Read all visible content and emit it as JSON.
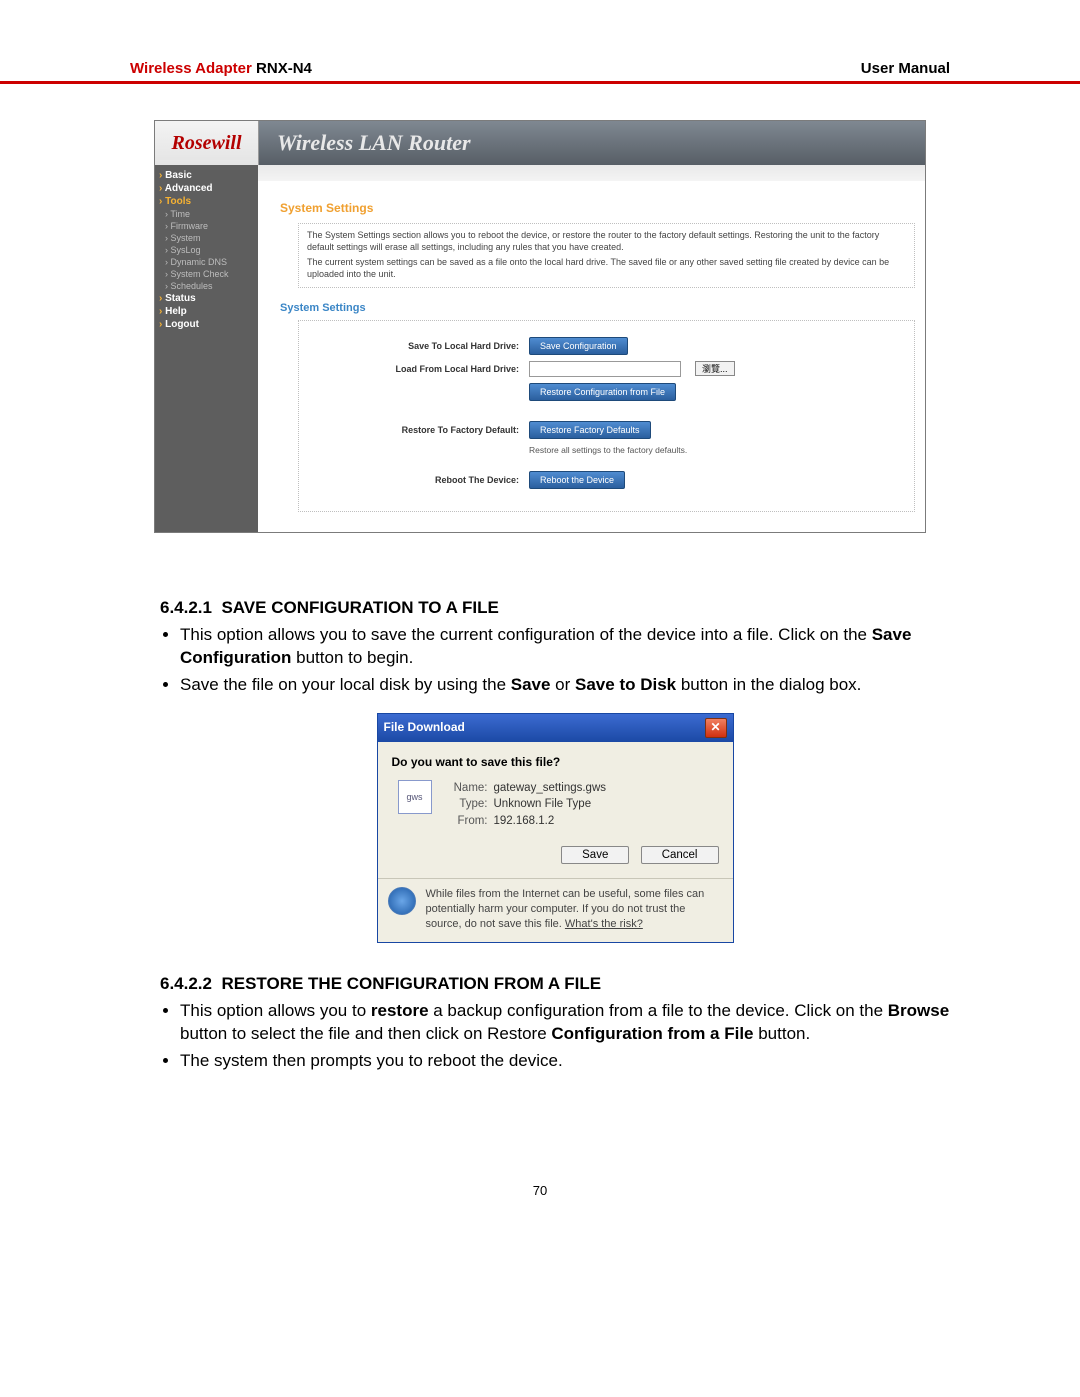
{
  "header": {
    "brand": "Wireless Adapter",
    "model": "RNX-N4",
    "right": "User Manual"
  },
  "router": {
    "logo": "Rosewill",
    "title": "Wireless LAN Router",
    "sidebar": {
      "basic": "Basic",
      "advanced": "Advanced",
      "tools": "Tools",
      "sub": {
        "time": "Time",
        "firmware": "Firmware",
        "system": "System",
        "syslog": "SysLog",
        "ddns": "Dynamic DNS",
        "syscheck": "System Check",
        "schedules": "Schedules"
      },
      "status": "Status",
      "help": "Help",
      "logout": "Logout"
    },
    "section_title": "System Settings",
    "help_p1": "The System Settings section allows you to reboot the device, or restore the router to the factory default settings. Restoring the unit to the factory default settings will erase all settings, including any rules that you have created.",
    "help_p2": "The current system settings can be saved as a file onto the local hard drive. The saved file or any other saved setting file created by device can be uploaded into the unit.",
    "section_title2": "System Settings",
    "labels": {
      "save": "Save To Local Hard Drive:",
      "load": "Load From Local Hard Drive:",
      "restore": "Restore To Factory Default:",
      "reboot": "Reboot The Device:"
    },
    "buttons": {
      "save_cfg": "Save Configuration",
      "browse": "瀏覽...",
      "restore_file": "Restore Configuration from File",
      "factory": "Restore Factory Defaults",
      "reboot": "Reboot the Device"
    },
    "caption_factory": "Restore all settings to the factory defaults."
  },
  "doc": {
    "h1_num": "6.4.2.1",
    "h1_txt": "SAVE CONFIGURATION TO A FILE",
    "b1a_pre": "This option allows you to save the current configuration of the device into a file. Click on the ",
    "b1a_bold": "Save Configuration",
    "b1a_post": " button to begin.",
    "b1b_pre": "Save the file on your local disk by using the ",
    "b1b_bold1": "Save",
    "b1b_mid": " or ",
    "b1b_bold2": "Save to Disk",
    "b1b_post": " button in the dialog box.",
    "h2_num": "6.4.2.2",
    "h2_txt": "RESTORE THE CONFIGURATION FROM A FILE",
    "b2a_pre": "This option allows you to ",
    "b2a_bold1": "restore",
    "b2a_mid1": " a backup configuration from a file to the device. Click on the ",
    "b2a_bold2": "Browse",
    "b2a_mid2": " button to select the file and then click on Restore ",
    "b2a_bold3": "Configuration from a File",
    "b2a_post": " button.",
    "b2b": "The system then prompts you to reboot the device."
  },
  "dlg": {
    "title": "File Download",
    "question": "Do you want to save this file?",
    "name_k": "Name:",
    "name_v": "gateway_settings.gws",
    "type_k": "Type:",
    "type_v": "Unknown File Type",
    "from_k": "From:",
    "from_v": "192.168.1.2",
    "save": "Save",
    "cancel": "Cancel",
    "foot": "While files from the Internet can be useful, some files can potentially harm your computer. If you do not trust the source, do not save this file. ",
    "foot_link": "What's the risk?"
  },
  "page_number": "70"
}
